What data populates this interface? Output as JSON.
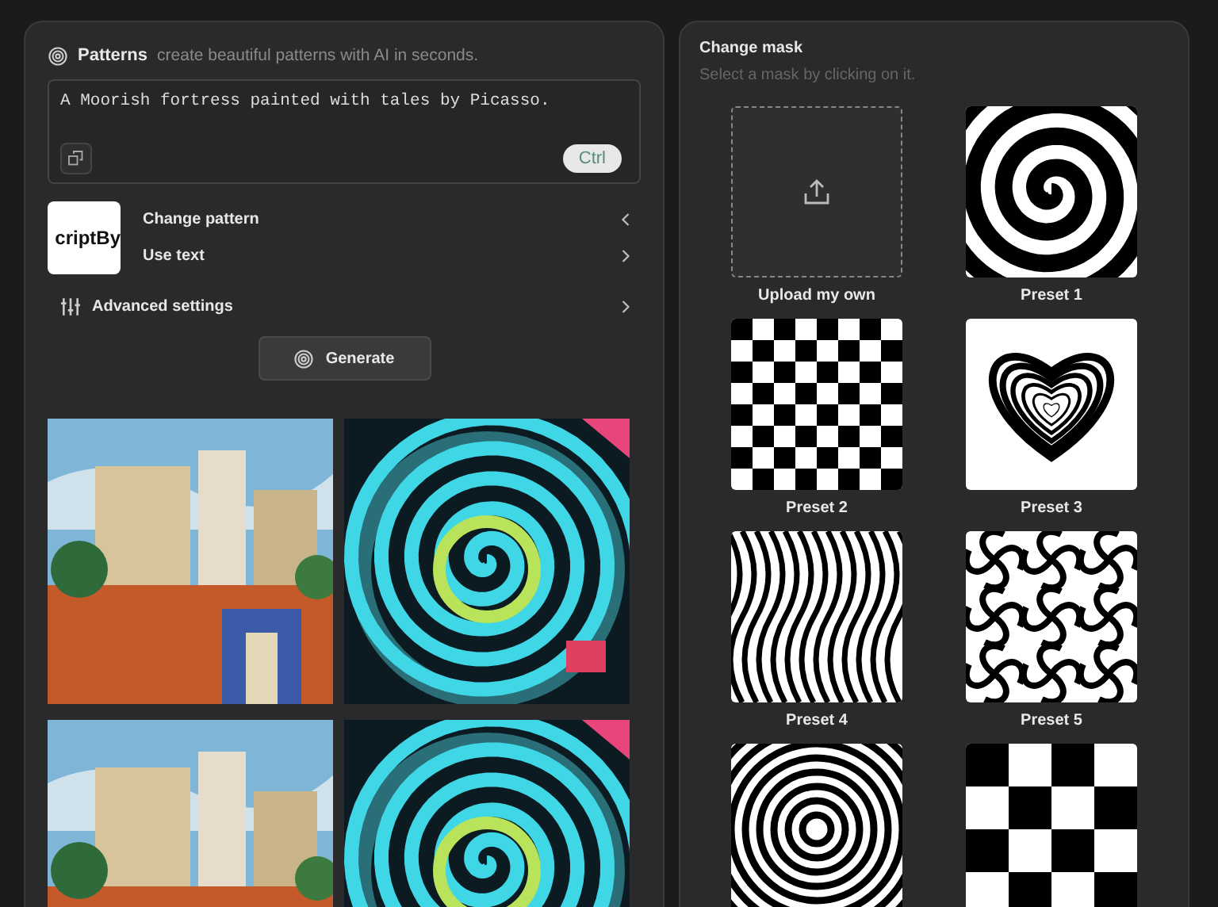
{
  "generator": {
    "title": "Patterns",
    "subtitle": "create beautiful patterns with AI in seconds.",
    "prompt": "A Moorish fortress painted with tales by Picasso.",
    "shortcut_hint": "Ctrl",
    "pattern_thumbnail": "criptBy",
    "options": [
      {
        "label": "Change pattern",
        "expanded": true
      },
      {
        "label": "Use text",
        "expanded": false
      }
    ],
    "advanced": {
      "label": "Advanced settings",
      "expanded": false
    },
    "generate_button": "Generate"
  },
  "results": [
    {
      "kind": "picture"
    },
    {
      "kind": "picture"
    },
    {
      "kind": "picture"
    },
    {
      "kind": "picture"
    }
  ],
  "mask_panel": {
    "title": "Change mask",
    "subtitle": "Select a mask by clicking on it.",
    "upload_label": "Upload my own",
    "presets": [
      {
        "kind": "picture",
        "label": "Preset 1"
      },
      {
        "kind": "picture",
        "label": "Preset 2"
      },
      {
        "kind": "picture",
        "label": "Preset 3"
      },
      {
        "kind": "picture",
        "label": "Preset 4"
      },
      {
        "kind": "picture",
        "label": "Preset 5"
      },
      {
        "kind": "picture"
      },
      {
        "kind": "picture"
      }
    ]
  }
}
